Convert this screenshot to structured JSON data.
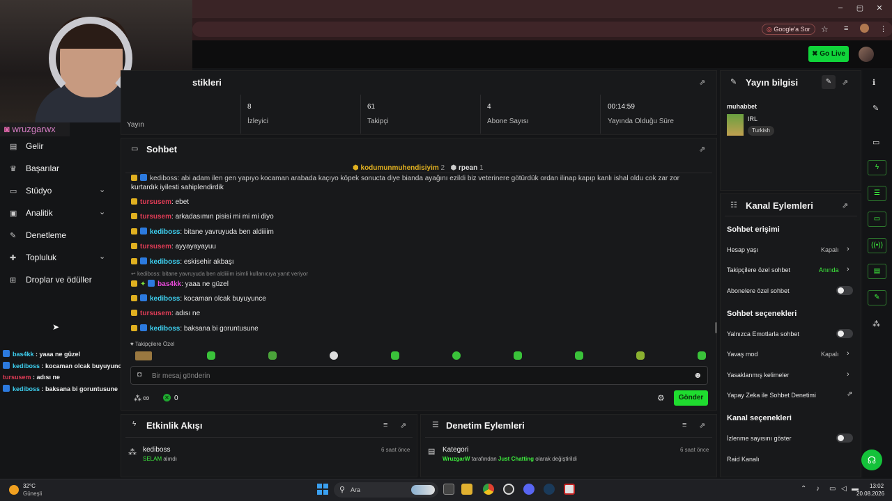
{
  "browser": {
    "google_sor": "Google'a Sor",
    "window_controls": [
      "–",
      "▢",
      "✕"
    ]
  },
  "topnav": {
    "go_live": "Go Live"
  },
  "webcam": {
    "ig_handle": "wruzgarwx"
  },
  "sidebar": {
    "items": [
      {
        "label": "Gelir",
        "icon": "money-icon"
      },
      {
        "label": "Başarılar",
        "icon": "trophy-icon"
      },
      {
        "label": "Stüdyo",
        "icon": "studio-icon",
        "expandable": true
      },
      {
        "label": "Analitik",
        "icon": "chart-icon",
        "expandable": true
      },
      {
        "label": "Denetleme",
        "icon": "wrench-icon"
      },
      {
        "label": "Topluluk",
        "icon": "community-icon",
        "expandable": true
      },
      {
        "label": "Droplar ve ödüller",
        "icon": "gift-icon"
      }
    ]
  },
  "overlay_chat": [
    {
      "user": "bas4kk",
      "text": " : yaaa ne güzel"
    },
    {
      "user": "kediboss",
      "text": " : kocaman olcak buyuyunce"
    },
    {
      "user": "tursusem",
      "text": " : adısı ne"
    },
    {
      "user": "kediboss",
      "text": " : baksana bi goruntusune"
    }
  ],
  "stats": {
    "title_partial": "stikleri",
    "cells": [
      {
        "value": "",
        "label": "Yayın"
      },
      {
        "value": "8",
        "label": "İzleyici"
      },
      {
        "value": "61",
        "label": "Takipçi"
      },
      {
        "value": "4",
        "label": "Abone Sayısı"
      },
      {
        "value": "00:14:59",
        "label": "Yayında Olduğu Süre"
      }
    ]
  },
  "chat": {
    "title": "Sohbet",
    "top_gifters": [
      {
        "name": "kodumunmuhendisiyim",
        "count": "2"
      },
      {
        "name": "rpean",
        "count": "1"
      }
    ],
    "first_line": "kediboss: abi adam ilen gen yapıyo kocaman arabada kaçıyo köpek sonucta diye bianda ayağını ezildi biz veterinere götürdük ordan ilinap kapıp kanlı ishal oldu cok zar zor",
    "first_line_cont": "kurtardık iyilesti sahiplendirdik",
    "messages": [
      {
        "user": "tursusem",
        "text": ": ebet",
        "color": "red"
      },
      {
        "user": "tursusem",
        "text": ": arkadasımın pisisi mi mi mi diyo",
        "color": "red"
      },
      {
        "user": "kediboss",
        "text": ": bitane yavruyuda ben aldiiiim",
        "color": "cyan"
      },
      {
        "user": "tursusem",
        "text": ": ayyayayayuu",
        "color": "red"
      },
      {
        "user": "kediboss",
        "text": ": eskisehir akbaşı",
        "color": "cyan"
      }
    ],
    "reply_note": "kediboss: bitane yavruyuda ben aldiiiim isimli kullanıcıya yanıt veriyor",
    "messages2": [
      {
        "user": "bas4kk",
        "text": ": yaaa ne güzel",
        "color": "pink"
      },
      {
        "user": "kediboss",
        "text": ": kocaman olcak buyuyunce",
        "color": "cyan"
      },
      {
        "user": "tursusem",
        "text": ": adısı ne",
        "color": "red"
      },
      {
        "user": "kediboss",
        "text": ": baksana bi goruntusune",
        "color": "cyan"
      }
    ],
    "followers_only": "Takipçilere Özel",
    "input_placeholder": "Bir mesaj gönderin",
    "infinity": "∞",
    "points": "0",
    "send": "Gönder"
  },
  "activity": {
    "title": "Etkinlik Akışı",
    "items": [
      {
        "user": "kediboss",
        "detail": "SELAM",
        "detail_suffix": " alındı",
        "time": "6 saat önce"
      }
    ]
  },
  "moderation": {
    "title": "Denetim Eylemleri",
    "items": [
      {
        "title": "Kategori",
        "user": "WruzgarW",
        "mid": " tarafından ",
        "cat": "Just Chatting",
        "end": " olarak değiştirildi",
        "time": "6 saat önce"
      }
    ]
  },
  "stream_info": {
    "title": "Yayın bilgisi",
    "stream_title": "muhabbet",
    "category": "IRL",
    "language": "Turkish"
  },
  "channel_actions": {
    "title": "Kanal Eylemleri",
    "sections": {
      "chat_access": "Sohbet erişimi",
      "chat_options": "Sohbet seçenekleri",
      "channel_options": "Kanal seçenekleri"
    },
    "rows": {
      "account_age": {
        "label": "Hesap yaşı",
        "value": "Kapalı"
      },
      "followers_only": {
        "label": "Takipçilere özel sohbet",
        "value": "Anında"
      },
      "subs_only": {
        "label": "Abonelere özel sohbet"
      },
      "emote_only": {
        "label": "Yalnızca Emotlarla sohbet"
      },
      "slow_mode": {
        "label": "Yavaş mod",
        "value": "Kapalı"
      },
      "banned_words": {
        "label": "Yasaklanmış kelimeler"
      },
      "ai_moderation": {
        "label": "Yapay Zeka ile Sohbet Denetimi"
      },
      "show_viewcount": {
        "label": "İzlenme sayısını göster"
      },
      "raid_channel": {
        "label": "Raid Kanalı"
      }
    }
  },
  "taskbar": {
    "weather_temp": "32°C",
    "weather_desc": "Güneşli",
    "search": "Ara",
    "time": "13:02",
    "date": "20.08.2026"
  }
}
